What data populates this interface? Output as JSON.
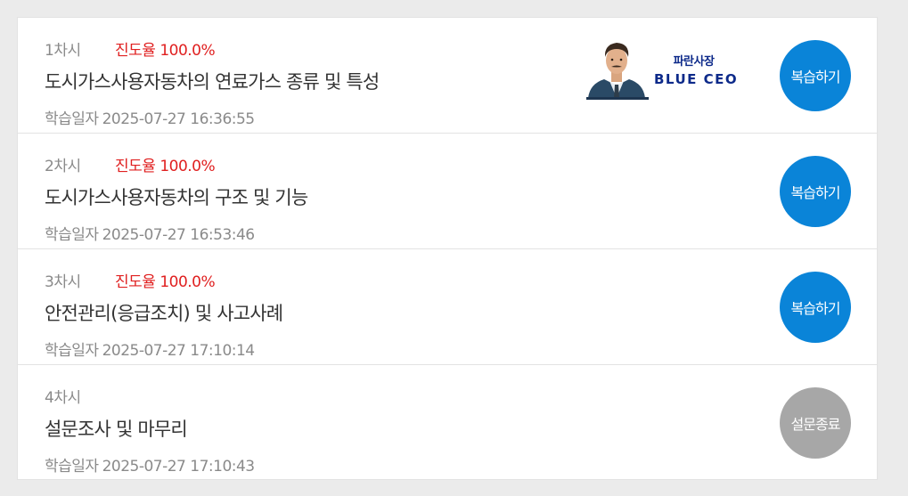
{
  "logo": {
    "kr": "파란사장",
    "en": "BLUE CEO"
  },
  "date_label": "학습일자",
  "rows": [
    {
      "session": "1차시",
      "progress": "진도율 100.0%",
      "title": "도시가스사용자동차의 연료가스 종류 및 특성",
      "date": "2025-07-27 16:36:55",
      "action": "복습하기"
    },
    {
      "session": "2차시",
      "progress": "진도율 100.0%",
      "title": "도시가스사용자동차의 구조 및 기능",
      "date": "2025-07-27 16:53:46",
      "action": "복습하기"
    },
    {
      "session": "3차시",
      "progress": "진도율 100.0%",
      "title": "안전관리(응급조치) 및 사고사례",
      "date": "2025-07-27 17:10:14",
      "action": "복습하기"
    },
    {
      "session": "4차시",
      "progress": "",
      "title": "설문조사 및 마무리",
      "date": "2025-07-27 17:10:43",
      "action": "설문종료"
    }
  ],
  "colors": {
    "review_button": "#0a84d8",
    "done_button": "#a7a7a7",
    "progress_text": "#e02020"
  }
}
